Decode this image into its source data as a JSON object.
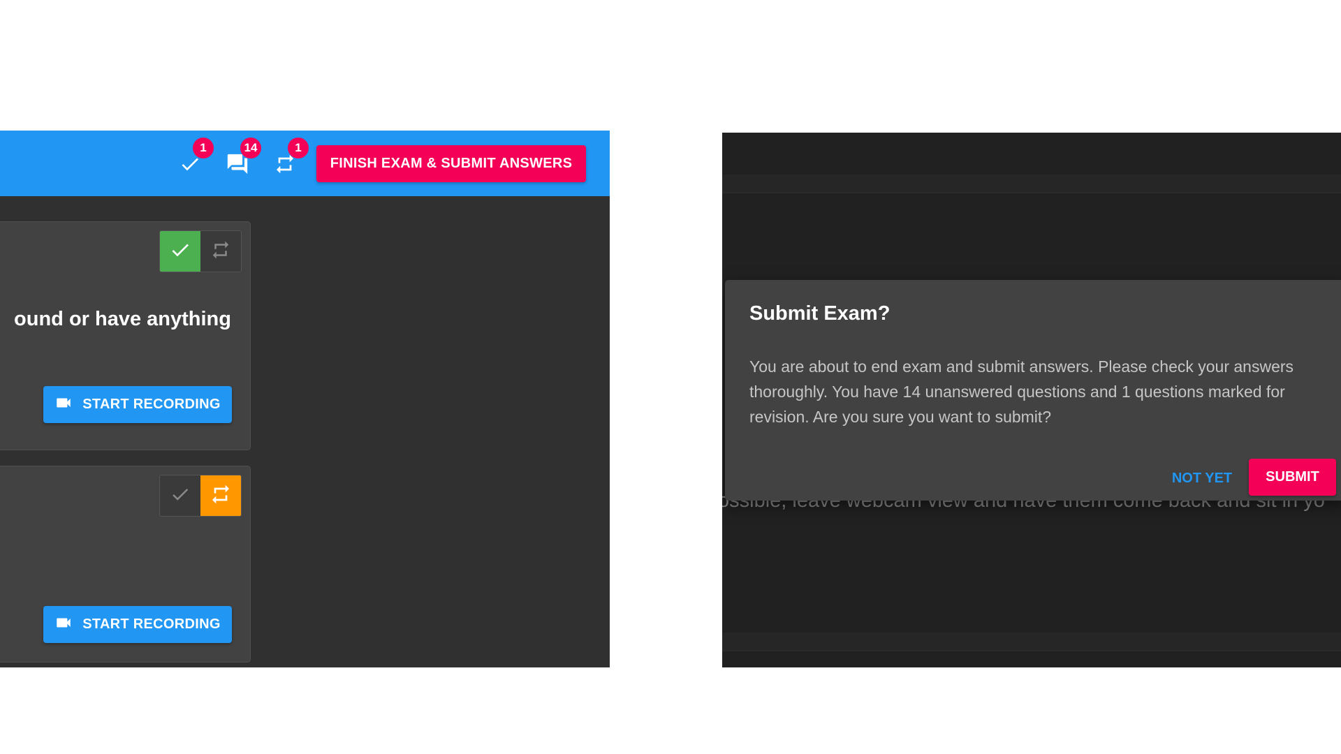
{
  "colors": {
    "primary": "#2196f3",
    "accent": "#f50057",
    "success": "#4caf50",
    "warning": "#ff9800",
    "panel_bg": "#303030",
    "card_bg": "#424242"
  },
  "toolbar": {
    "answered": {
      "icon": "check-icon",
      "badge": "1"
    },
    "unanswered": {
      "icon": "chat-icon",
      "badge": "14"
    },
    "revision": {
      "icon": "repeat-icon",
      "badge": "1"
    },
    "finish_label": "FINISH EXAM & SUBMIT ANSWERS"
  },
  "cards": [
    {
      "text": "ound or have anything",
      "answered": true,
      "marked_for_revision": false,
      "record_label": "START RECORDING",
      "record_icon": "videocam-icon"
    },
    {
      "text": "",
      "answered": false,
      "marked_for_revision": true,
      "record_label": "START RECORDING",
      "record_icon": "videocam-icon"
    }
  ],
  "background": {
    "text": "ossible, leave webcam view and have them come back and sit in yo"
  },
  "dialog": {
    "title": "Submit Exam?",
    "body": "You are about to end exam and submit answers. Please check your answers thoroughly. You have 14 unanswered questions and 1 questions marked for revision. Are you sure you want to submit?",
    "cancel_label": "NOT YET",
    "confirm_label": "SUBMIT"
  }
}
